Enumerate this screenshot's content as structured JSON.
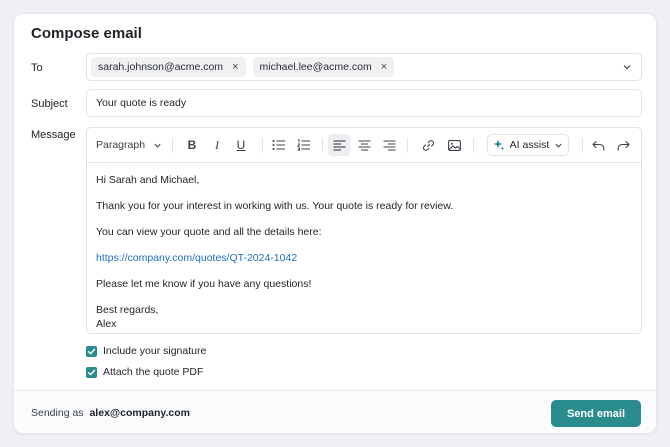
{
  "title": "Compose email",
  "to": {
    "label": "To",
    "recipients": [
      "sarah.johnson@acme.com",
      "michael.lee@acme.com"
    ],
    "remove_glyph": "×"
  },
  "subject": {
    "label": "Subject",
    "value": "Your quote is ready"
  },
  "message": {
    "label": "Message",
    "toolbar": {
      "paragraph_style": "Paragraph",
      "bold": "B",
      "italic": "I",
      "underline": "U",
      "alignment_selected": "left",
      "ai_assist": "AI assist"
    },
    "body": {
      "greeting": "Hi Sarah and Michael,",
      "line1": "Thank you for your interest in working with us. Your quote is ready for review.",
      "line2": "You can view your quote and all the details here:",
      "link": "https://company.com/quotes/QT-2024-1042",
      "line3": "Please let me know if you have any questions!",
      "closing": "Best regards,",
      "signature_name": "Alex"
    }
  },
  "options": {
    "include_signature": {
      "label": "Include your signature",
      "checked": true
    },
    "attach_pdf": {
      "label": "Attach the quote PDF",
      "checked": true
    }
  },
  "footer": {
    "sending_as_label": "Sending as",
    "sending_as_email": "alex@company.com",
    "send_label": "Send email"
  },
  "colors": {
    "accent": "#2a8c8c",
    "link": "#1f6fc6"
  }
}
